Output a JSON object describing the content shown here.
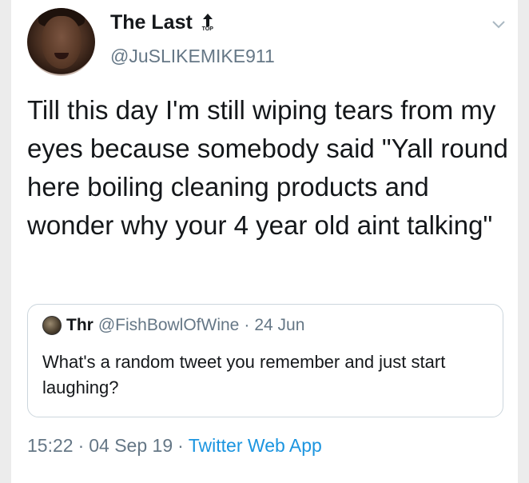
{
  "tweet": {
    "display_name": "The Last",
    "badge_text": "TOP",
    "handle": "@JuSLIKEMIKE911",
    "text": "Till this day I'm still wiping tears from my eyes because somebody said \"Yall round here boiling cleaning products and wonder why your 4 year old aint talking\"",
    "time": "15:22",
    "date": "04 Sep 19",
    "source": "Twitter Web App",
    "separator": "·"
  },
  "quoted_tweet": {
    "display_name": "Thr",
    "handle": "@FishBowlOfWine",
    "separator": "·",
    "date": "24 Jun",
    "text": "What's a random tweet you remember and just start laughing?"
  },
  "icons": {
    "menu": "chevron-down-icon",
    "badge": "top-arrow-icon"
  },
  "colors": {
    "link": "#1b95e0",
    "secondary_text": "#657786",
    "primary_text": "#14171a",
    "border": "#ccd6dd"
  }
}
